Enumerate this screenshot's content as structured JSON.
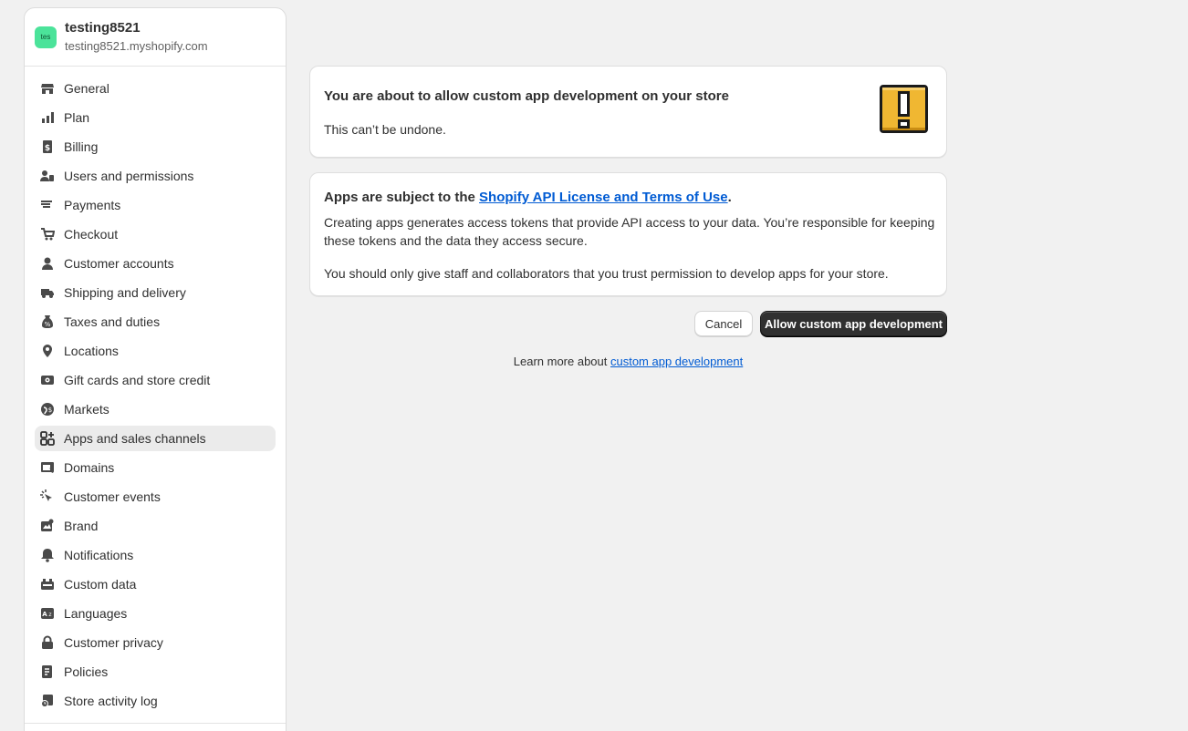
{
  "store": {
    "avatar_text": "tes",
    "name": "testing8521",
    "domain": "testing8521.myshopify.com"
  },
  "sidebar": {
    "items": [
      {
        "label": "General",
        "icon": "store-icon"
      },
      {
        "label": "Plan",
        "icon": "plan-icon"
      },
      {
        "label": "Billing",
        "icon": "billing-icon"
      },
      {
        "label": "Users and permissions",
        "icon": "users-icon"
      },
      {
        "label": "Payments",
        "icon": "payments-icon"
      },
      {
        "label": "Checkout",
        "icon": "cart-icon"
      },
      {
        "label": "Customer accounts",
        "icon": "person-icon"
      },
      {
        "label": "Shipping and delivery",
        "icon": "truck-icon"
      },
      {
        "label": "Taxes and duties",
        "icon": "tax-icon"
      },
      {
        "label": "Locations",
        "icon": "location-icon"
      },
      {
        "label": "Gift cards and store credit",
        "icon": "gift-card-icon"
      },
      {
        "label": "Markets",
        "icon": "globe-icon"
      },
      {
        "label": "Apps and sales channels",
        "icon": "apps-icon",
        "active": true
      },
      {
        "label": "Domains",
        "icon": "domains-icon"
      },
      {
        "label": "Customer events",
        "icon": "cursor-icon"
      },
      {
        "label": "Brand",
        "icon": "brand-icon"
      },
      {
        "label": "Notifications",
        "icon": "bell-icon"
      },
      {
        "label": "Custom data",
        "icon": "custom-data-icon"
      },
      {
        "label": "Languages",
        "icon": "language-icon"
      },
      {
        "label": "Customer privacy",
        "icon": "lock-icon"
      },
      {
        "label": "Policies",
        "icon": "policies-icon"
      },
      {
        "label": "Store activity log",
        "icon": "activity-log-icon"
      }
    ]
  },
  "warning": {
    "title": "You are about to allow custom app development on your store",
    "text": "This can’t be undone.",
    "illustration": "exclamation-block-icon"
  },
  "terms": {
    "heading_prefix": "Apps are subject to the ",
    "link_label": "Shopify API License and Terms of Use",
    "heading_suffix": ".",
    "p1": "Creating apps generates access tokens that provide API access to your data. You’re responsible for keeping these tokens and the data they access secure.",
    "p2": "You should only give staff and collaborators that you trust permission to develop apps for your store."
  },
  "actions": {
    "cancel_label": "Cancel",
    "primary_label": "Allow custom app development"
  },
  "learn_more": {
    "prefix": "Learn more about ",
    "link_label": "custom app development"
  },
  "colors": {
    "background": "#f1f1f1",
    "avatar": "#4be39a",
    "link": "#005bd3",
    "primary_button": "#303030",
    "illustration_fill": "#f0b732"
  }
}
